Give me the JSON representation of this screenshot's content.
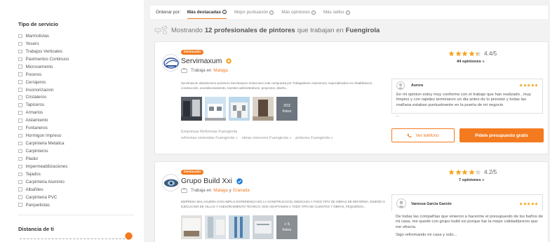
{
  "sidebar": {
    "service_title": "Tipo de servicio",
    "services": [
      "Marmolistas",
      "Yesero",
      "Trabajos Verticales",
      "Pavimentos Continuos",
      "Microcemento",
      "Poceros",
      "Cerrajeros",
      "Insonorizacion",
      "Cristaleros",
      "Tapiceros",
      "Armarios",
      "Aislamiento",
      "Fontaneros",
      "Hormigon Impreso",
      "Carpinteria Metalica",
      "Carpinteros",
      "Pladur",
      "Impermeabilizaciones",
      "Tejados",
      "Carpinteria Aluminio",
      "Albañiles",
      "Carpinteria PVC",
      "Parquetistas"
    ],
    "distance_title": "Distancia de ti"
  },
  "sort": {
    "label": "Ordenar por:",
    "options": [
      {
        "label": "Más destacadas"
      },
      {
        "label": "Mejor puntuación"
      },
      {
        "label": "Más opiniones"
      },
      {
        "label": "Más sellos"
      }
    ],
    "info_glyph": "i"
  },
  "summary": {
    "prefix": "Mostrando",
    "count_text": "12 profesionales de pintores",
    "middle": "que trabajan en",
    "city": "Fuengirola"
  },
  "pros": [
    {
      "badge": "Destacada",
      "name": "Servimaxum",
      "location_prefix": "Trabaja en",
      "locations": [
        "Malaga"
      ],
      "description": "Servimaxum aislamientos acústicos Servimaxum Soluciones esta compuesta por Trabajadores Autonomos, especializados en rehabilitacion, construcción, acondicionamiento, tramites administrativos, proyectos, diseño...",
      "photos_more_count": "203",
      "photos_more_label": "fotos",
      "links": [
        "Empresas Reformas Fuengirola",
        "reformas viviendas Fuengirola »",
        "obras menores Fuengirola »",
        "pintores Fuengirola »"
      ],
      "rating": 4.4,
      "score_text": "4.4/5",
      "opinions": "44 opiniones »",
      "review": {
        "author": "Aurora",
        "text": "En mi opinion estoy muy conforme con el trabajo que han realizado , muy limpios y con rapidez terminaron un dia antes de lo previsto y todas las mañana estaban puntualmente en la puerta de mi negocio",
        "tail": "..."
      },
      "phone_button": "Ver teléfono",
      "quote_button": "Pídele presupuesto gratis"
    },
    {
      "badge": "Destacada",
      "name": "Grupo Build Xxi",
      "location_prefix": "Trabaja en",
      "locations": [
        "Malaga",
        "Granada"
      ],
      "location_joiner": "y",
      "description": "EMPRESA MALAGUEÑA CON AMPLIA EXPERIENCIA EN LA CONSTRUCCION, DEDICADA A TODO TIPO DE OBRAS DE REFORMA, DISEÑO O EJECUCION DE VILLAS Y ASESORAMIENTO TÉCNICO. NOS ADAPTAMOS A TODO TIPO DE CLIENTES Y OBRAS, PEQUEÑOS...",
      "photos_more_count": "+ 5",
      "photos_more_label": "fotos",
      "rating": 4.2,
      "score_text": "4.2/5",
      "opinions": "7 opiniones »",
      "review": {
        "author": "Vanessa García Garzón",
        "text": "De todas las compañías que vinieron a hacerme el presupuesto de los baños de mi casa, me quedé con grupo build xxi porque fue la mejor calidad/precio que me ofrecía.",
        "tail": "Sigo reformando mi casa y solo..."
      }
    }
  ],
  "colors": {
    "accent": "#f47a20",
    "star": "#f5a623",
    "verified": "#1f7bd6",
    "page_bg": "#f2f2f2"
  },
  "icons": [
    "checkbox-icon",
    "info-icon",
    "painter-tools-icon",
    "medal-icon",
    "verified-icon",
    "briefcase-icon",
    "star-icon",
    "avatar-icon",
    "phone-icon",
    "slider-knob-icon"
  ]
}
